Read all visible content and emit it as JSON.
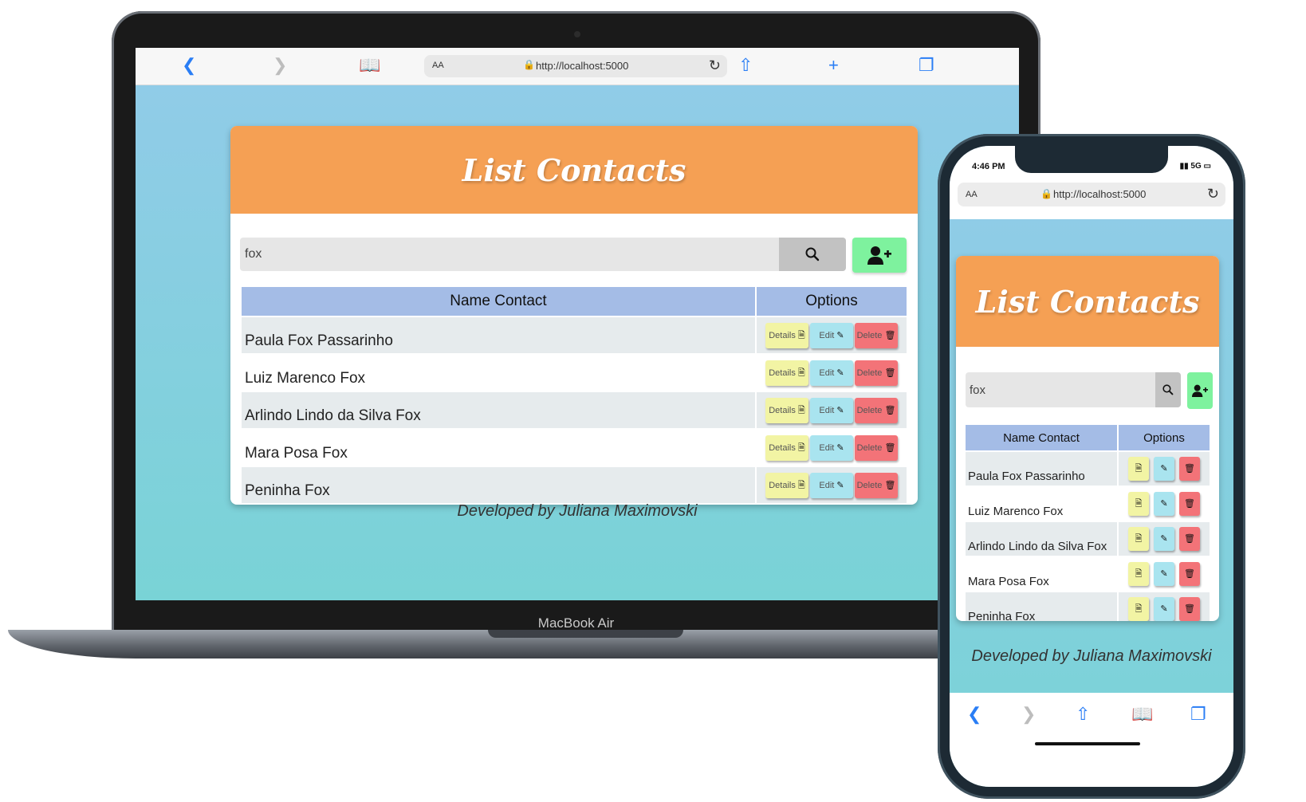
{
  "browser": {
    "url": "http://localhost:5000",
    "text_size_label": "AA",
    "icons": [
      "back-icon",
      "forward-icon",
      "bookmarks-icon",
      "lock-icon",
      "reload-icon",
      "share-icon",
      "new-tab-icon",
      "tabs-icon"
    ]
  },
  "laptop": {
    "label": "MacBook Air"
  },
  "phone": {
    "time": "4:46 PM",
    "signal": "5G"
  },
  "app": {
    "title": "List Contacts",
    "search_value": "fox",
    "search_icon": "search-icon",
    "add_icon": "add-user-icon",
    "columns": [
      "Name Contact",
      "Options"
    ],
    "buttons": {
      "details": "Details",
      "edit": "Edit",
      "delete": "Delete"
    },
    "contacts": [
      {
        "name": "Paula Fox Passarinho"
      },
      {
        "name": "Luiz Marenco Fox"
      },
      {
        "name": "Arlindo Lindo da Silva Fox"
      },
      {
        "name": "Mara Posa Fox"
      },
      {
        "name": "Peninha Fox"
      }
    ],
    "footer": "Developed by Juliana Maximovski"
  },
  "colors": {
    "header": "#f5a054",
    "add_button": "#7ef29e",
    "table_header": "#a4bce6",
    "details": "#f2f4a4",
    "edit": "#a9e4ef",
    "delete": "#f37378",
    "background_top": "#92cbe9",
    "background_bottom": "#79d3d6"
  }
}
